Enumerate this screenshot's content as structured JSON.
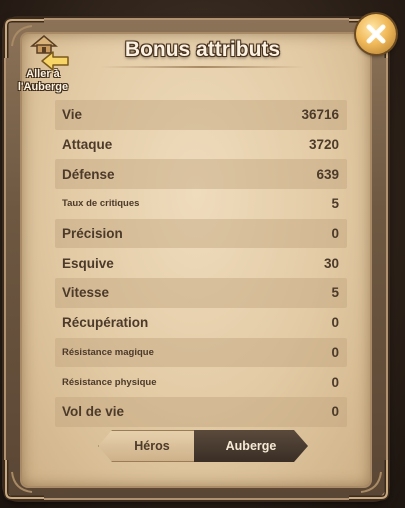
{
  "dialog": {
    "title": "Bonus attributs",
    "goto_inn_label": "Aller à l'Auberge",
    "close_icon": "close-icon"
  },
  "stats": [
    {
      "label": "Vie",
      "value": "36716",
      "small": false
    },
    {
      "label": "Attaque",
      "value": "3720",
      "small": false
    },
    {
      "label": "Défense",
      "value": "639",
      "small": false
    },
    {
      "label": "Taux de critiques",
      "value": "5",
      "small": true
    },
    {
      "label": "Précision",
      "value": "0",
      "small": false
    },
    {
      "label": "Esquive",
      "value": "30",
      "small": false
    },
    {
      "label": "Vitesse",
      "value": "5",
      "small": false
    },
    {
      "label": "Récupération",
      "value": "0",
      "small": false
    },
    {
      "label": "Résistance magique",
      "value": "0",
      "small": true
    },
    {
      "label": "Résistance physique",
      "value": "0",
      "small": true
    },
    {
      "label": "Vol de vie",
      "value": "0",
      "small": false
    }
  ],
  "tabs": {
    "heros": "Héros",
    "auberge": "Auberge",
    "active": "auberge"
  },
  "colors": {
    "parchment": "#e2caa4",
    "text": "#4c3a2a",
    "active_tab": "#3a2e25",
    "close_button": "#f0b95a"
  }
}
